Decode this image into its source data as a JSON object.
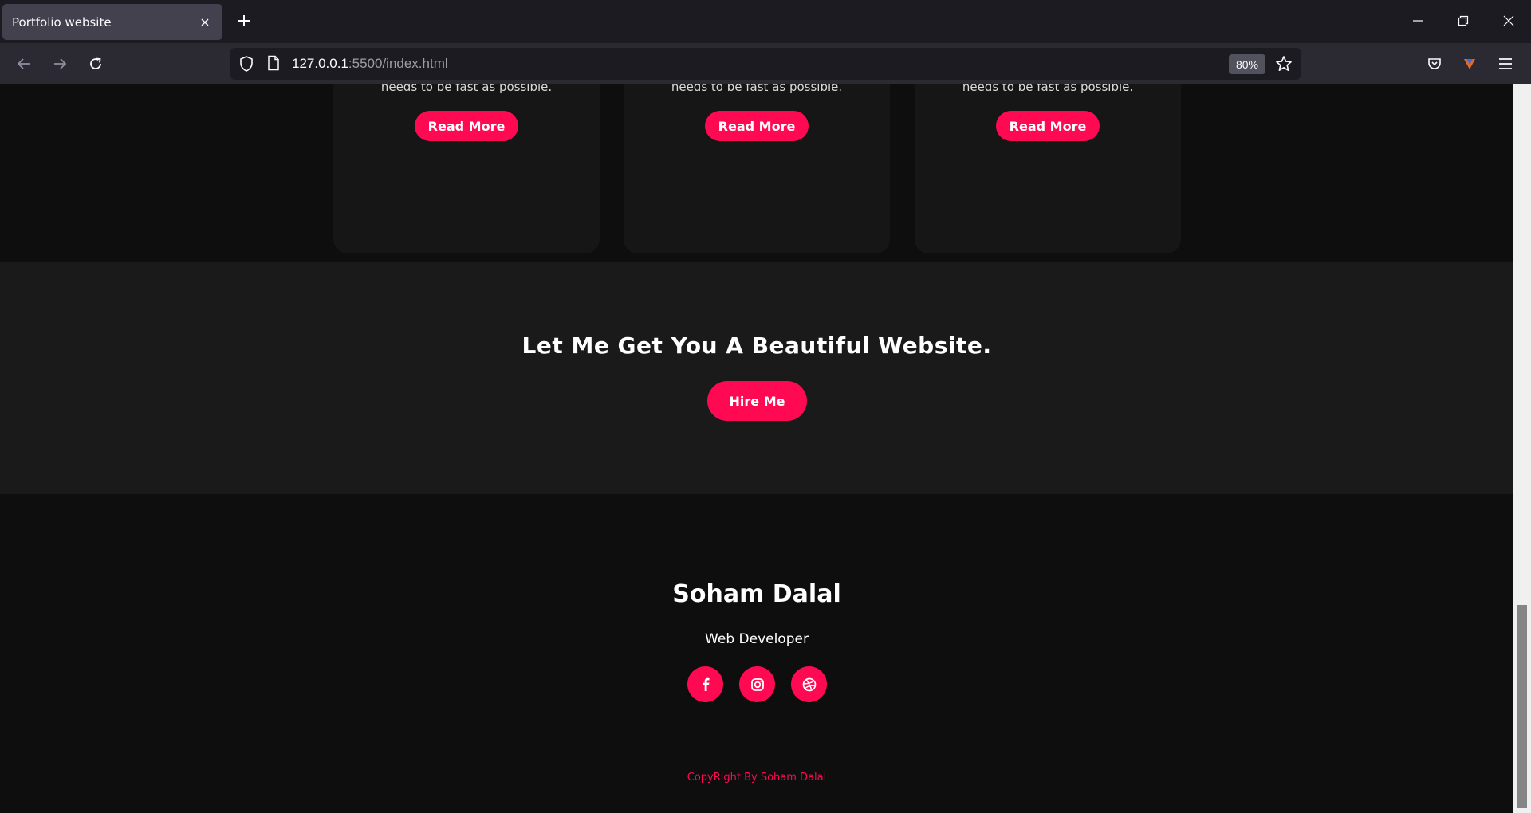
{
  "browser": {
    "tab_title": "Portfolio website",
    "url_host": "127.0.0.1",
    "url_rest": ":5500/index.html",
    "zoom": "80%"
  },
  "services": {
    "cards": [
      {
        "text": "needs to be fast as possible.",
        "button": "Read More"
      },
      {
        "text": "needs to be fast as possible.",
        "button": "Read More"
      },
      {
        "text": "needs to be fast as possible.",
        "button": "Read More"
      }
    ]
  },
  "hire": {
    "title": "Let Me Get You A Beautiful Website.",
    "button": "Hire Me"
  },
  "footer": {
    "name": "Soham Dalal",
    "role": "Web Developer",
    "social": [
      "facebook-icon",
      "instagram-icon",
      "dribbble-icon"
    ],
    "copyright": "CopyRight By Soham Dalal"
  },
  "colors": {
    "accent": "#ff0a52",
    "page_bg": "#0e0e0f",
    "section_bg": "#1a1a1b",
    "card_bg": "#161617"
  }
}
